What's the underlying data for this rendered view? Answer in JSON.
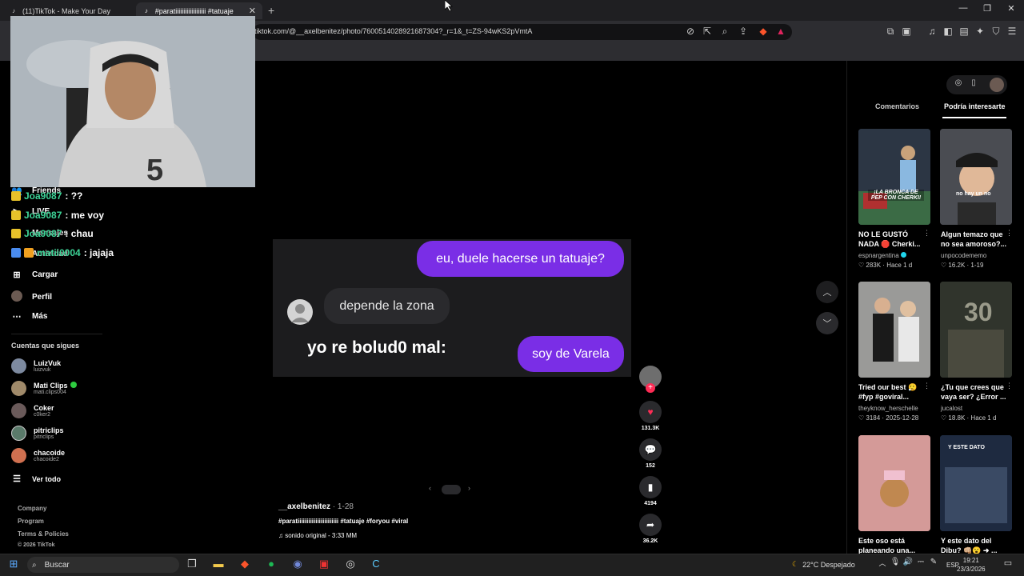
{
  "browser": {
    "tabs": [
      {
        "label": "(11)TikTok - Make Your Day",
        "active": false
      },
      {
        "label": "#paratiiiiiiiiiiiiiiiiiii #tatuaje",
        "active": true
      }
    ],
    "url": "tiktok.com/@__axelbenitez/photo/7600514028921687304?_r=1&_t=ZS-94wKS2pVmtA",
    "window_controls": [
      "minimize",
      "maximize",
      "close"
    ]
  },
  "sidebar": {
    "nav": [
      {
        "label": "Friends",
        "icon": "friends-icon"
      },
      {
        "label": "LIVE",
        "icon": "live-icon"
      },
      {
        "label": "Mensajes",
        "icon": "messages-icon"
      },
      {
        "label": "Actividad",
        "icon": "activity-icon"
      },
      {
        "label": "Cargar",
        "icon": "upload-icon"
      },
      {
        "label": "Perfil",
        "icon": "profile-icon"
      },
      {
        "label": "Más",
        "icon": "more-icon"
      }
    ],
    "following_title": "Cuentas que sigues",
    "accounts": [
      {
        "name": "LuizVuk",
        "handle": "luizvuk",
        "color": "#7d8aa0",
        "live": false
      },
      {
        "name": "Mati Clips",
        "handle": "mati.clips004",
        "color": "#a08a6a",
        "live": true
      },
      {
        "name": "Coker",
        "handle": "c0ker2",
        "color": "#6a5a5a",
        "live": false
      },
      {
        "name": "pitriclips",
        "handle": "pitriclips",
        "color": "#5a7a6a",
        "live": false
      },
      {
        "name": "chacoide",
        "handle": "chacoide2",
        "color": "#d07050",
        "live": false
      }
    ],
    "see_all": "Ver todo",
    "footer": [
      "Company",
      "Program",
      "Terms & Policies",
      "© 2026 TikTok"
    ]
  },
  "stream_chat": [
    {
      "user": "Joa9087",
      "message": ": ??"
    },
    {
      "user": "Joa9087",
      "message": ": me voy"
    },
    {
      "user": "Joa9087",
      "message": ": chau"
    },
    {
      "user": "matii0004",
      "message": ": jajaja"
    }
  ],
  "post": {
    "bubbles": {
      "q": "eu, duele hacerse un tatuaje?",
      "a": "depende la zona",
      "b": "soy de Varela"
    },
    "overlay_text": "yo re bolud0 mal:",
    "author": "__axelbenitez",
    "date": " · 1-28",
    "caption": "#paratiiiiiiiiiiiiiiiiiiiiiii #tatuaje #foryou #viral",
    "sound": "sonido original - 3:33 MM",
    "actions": {
      "likes": "131.3K",
      "comments": "152",
      "saves": "4194",
      "shares": "36.2K"
    },
    "accent_like": "#fe2c55"
  },
  "right_panel": {
    "tabs": [
      "Comentarios",
      "Podría interesarte"
    ],
    "active_tab": "Podría interesarte",
    "videos": [
      {
        "title": "NO LE GUSTÓ NADA 🛑 Cherki...",
        "author": "espnargentina",
        "verified": true,
        "stats": "♡ 283K · Hace 1 d",
        "overlay": "¡LA BRONCA DE PEP CON CHERKI!",
        "bg": "#3a4a5a"
      },
      {
        "title": "Algun temazo que no sea amoroso?...",
        "author": "unpocodememo",
        "verified": false,
        "stats": "♡ 16.2K · 1-19",
        "overlay": "no hay un no",
        "bg": "#5a5a60"
      },
      {
        "title": "Tried our best 😮‍💨 #fyp #goviral...",
        "author": "theyknow_herschelle",
        "verified": false,
        "stats": "♡ 3184 · 2025-12-28",
        "overlay": "",
        "bg": "#8a8a8a"
      },
      {
        "title": "¿Tu que crees que vaya ser? ¿Error ...",
        "author": "jucalost",
        "verified": false,
        "stats": "♡ 18.8K · Hace 1 d",
        "overlay": "30",
        "bg": "#3a3e34"
      },
      {
        "title": "Este oso está planeando una...",
        "author": "",
        "verified": false,
        "stats": "",
        "overlay": "",
        "bg": "#c98080"
      },
      {
        "title": "Y este dato del Dibu? 👊🏼😮 ➜ ...",
        "author": "",
        "verified": false,
        "stats": "",
        "overlay": "Y ESTE DATO",
        "bg": "#2c3e5a"
      }
    ]
  },
  "taskbar": {
    "search_placeholder": "Buscar",
    "weather": "22°C  Despejado",
    "lang": "ESP",
    "time": "19:21",
    "date": "23/3/2026"
  }
}
